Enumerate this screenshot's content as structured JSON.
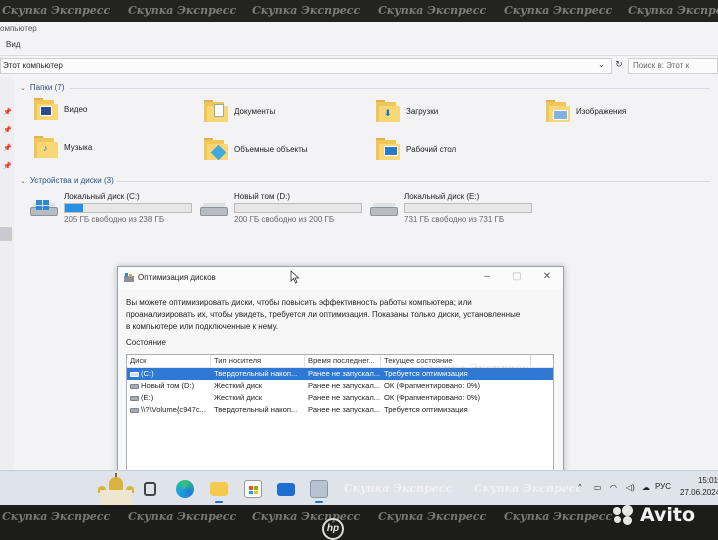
{
  "explorer": {
    "window_title": "омпьютер",
    "menu_view": "Вид",
    "address": "Этот компьютер",
    "search_placeholder": "Поиск в: Этот к",
    "folders_section": "Папки (7)",
    "folders": [
      {
        "label": "Видео",
        "icon": "video-folder-icon"
      },
      {
        "label": "Документы",
        "icon": "documents-folder-icon"
      },
      {
        "label": "Загрузки",
        "icon": "downloads-folder-icon"
      },
      {
        "label": "Изображения",
        "icon": "pictures-folder-icon"
      },
      {
        "label": "Музыка",
        "icon": "music-folder-icon"
      },
      {
        "label": "Объемные объекты",
        "icon": "3d-objects-folder-icon"
      },
      {
        "label": "Рабочий стол",
        "icon": "desktop-folder-icon"
      }
    ],
    "drives_section": "Устройства и диски (3)",
    "drives": [
      {
        "name": "Локальный диск (C:)",
        "free": "205 ГБ свободно из 238 ГБ",
        "used_fraction": 0.14,
        "icon": "windows-drive-icon"
      },
      {
        "name": "Новый том (D:)",
        "free": "200 ГБ свободно из 200 ГБ",
        "used_fraction": 0.0,
        "icon": "hard-drive-icon"
      },
      {
        "name": "Локальный диск (E:)",
        "free": "731 ГБ свободно из 731 ГБ",
        "used_fraction": 0.0,
        "icon": "hard-drive-icon"
      }
    ]
  },
  "dialog": {
    "title": "Оптимизация дисков",
    "description": "Вы можете оптимизировать диски, чтобы повысить эффективность работы  компьютера; или проанализировать их, чтобы увидеть, требуется ли оптимизация. Показаны только диски, установленные в компьютере или подключенные к нему.",
    "state_label": "Состояние",
    "columns": [
      "Диск",
      "Тип носителя",
      "Время последнег...",
      "Текущее состояние"
    ],
    "rows": [
      {
        "disk": "(C:)",
        "media": "Твердотельный накоп...",
        "last": "Ранее не запускал...",
        "status": "Требуется оптимизация",
        "selected": true
      },
      {
        "disk": "Новый том (D:)",
        "media": "Жесткий диск",
        "last": "Ранее не запускал...",
        "status": "ОК (Фрагментировано: 0%)",
        "selected": false
      },
      {
        "disk": "(E:)",
        "media": "Жесткий диск",
        "last": "Ранее не запускал...",
        "status": "ОК (Фрагментировано: 0%)",
        "selected": false
      },
      {
        "disk": "\\\\?\\Volume{c947c...",
        "media": "Твердотельный накоп...",
        "last": "Ранее не запускал...",
        "status": "Требуется оптимизация",
        "selected": false
      }
    ]
  },
  "taskbar": {
    "apps": [
      "task-view-icon",
      "edge-icon",
      "file-explorer-icon",
      "store-icon",
      "mail-icon",
      "defrag-icon"
    ],
    "tray_chevron": "^",
    "language": "РУС",
    "time": "15:01",
    "date": "27.06.2024"
  },
  "watermark": "Скупка Экспресс",
  "brand": {
    "laptop_logo": "hp",
    "marketplace": "Avito"
  },
  "colors": {
    "selection": "#2f78d3",
    "drive_fill": "#2a8fdc",
    "folder": "#f8d774",
    "section_head": "#2b4f7e"
  }
}
